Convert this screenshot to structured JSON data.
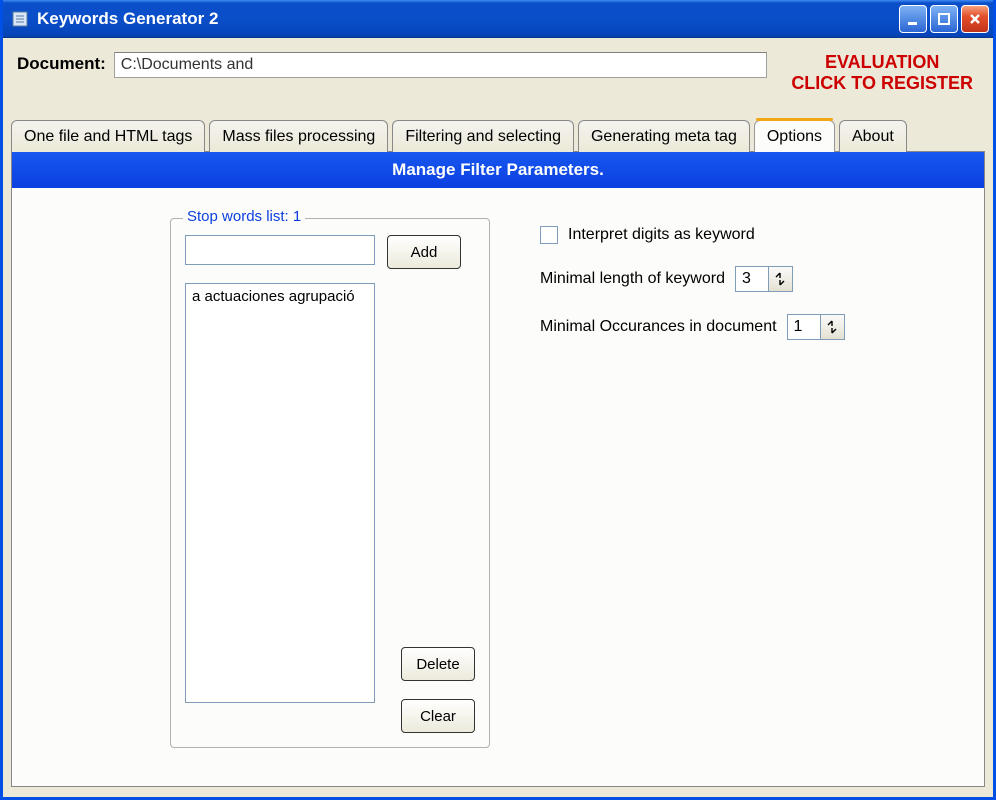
{
  "window": {
    "title": "Keywords Generator 2"
  },
  "header": {
    "document_label": "Document:",
    "document_value": "C:\\Documents and",
    "evaluation_line1": "EVALUATION",
    "evaluation_line2": "CLICK TO REGISTER"
  },
  "tabs": [
    {
      "label": "One file and HTML tags"
    },
    {
      "label": "Mass files processing"
    },
    {
      "label": "Filtering and selecting"
    },
    {
      "label": "Generating meta tag"
    },
    {
      "label": "Options"
    },
    {
      "label": "About"
    }
  ],
  "active_tab_index": 4,
  "panel": {
    "heading": "Manage Filter Parameters.",
    "stopwords": {
      "group_label": "Stop words list: 1",
      "input_value": "",
      "add_label": "Add",
      "delete_label": "Delete",
      "clear_label": "Clear",
      "list_items": [
        "a actuaciones agrupació"
      ]
    },
    "options": {
      "interpret_digits_label": "Interpret digits as keyword",
      "interpret_digits_checked": false,
      "min_length_label": "Minimal length of keyword",
      "min_length_value": "3",
      "min_occurrences_label": "Minimal Occurances in document",
      "min_occurrences_value": "1"
    }
  }
}
